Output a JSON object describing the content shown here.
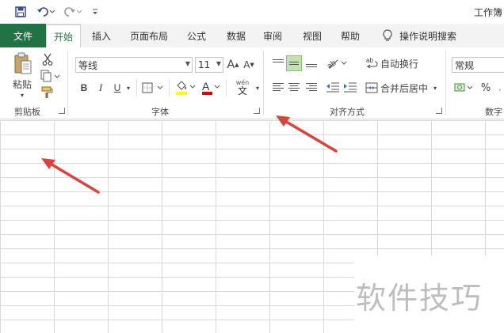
{
  "title_bar": {
    "title": "工作簿"
  },
  "tabs": [
    {
      "label": "文件"
    },
    {
      "label": "开始"
    },
    {
      "label": "插入"
    },
    {
      "label": "页面布局"
    },
    {
      "label": "公式"
    },
    {
      "label": "数据"
    },
    {
      "label": "审阅"
    },
    {
      "label": "视图"
    },
    {
      "label": "帮助"
    },
    {
      "label": "操作说明搜索"
    }
  ],
  "clipboard": {
    "paste_label": "粘贴",
    "group_label": "剪贴板"
  },
  "font": {
    "name": "等线",
    "size": "11",
    "grow": "A",
    "shrink": "A",
    "bold": "B",
    "italic": "I",
    "underline": "U",
    "font_color": "A",
    "phonetic_top": "wén",
    "phonetic_bottom": "文",
    "group_label": "字体"
  },
  "alignment": {
    "wrap_text": "自动换行",
    "merge_center": "合并后居中",
    "group_label": "对齐方式"
  },
  "number": {
    "format": "常规",
    "percent": "%",
    "group_label_partial": "数字"
  },
  "watermark": "软件技巧",
  "colors": {
    "file_tab": "#217346",
    "active_tab_text": "#217346",
    "arrow": "#d9433c",
    "highlight_yellow": "#ffff00",
    "font_red": "#e00000"
  }
}
